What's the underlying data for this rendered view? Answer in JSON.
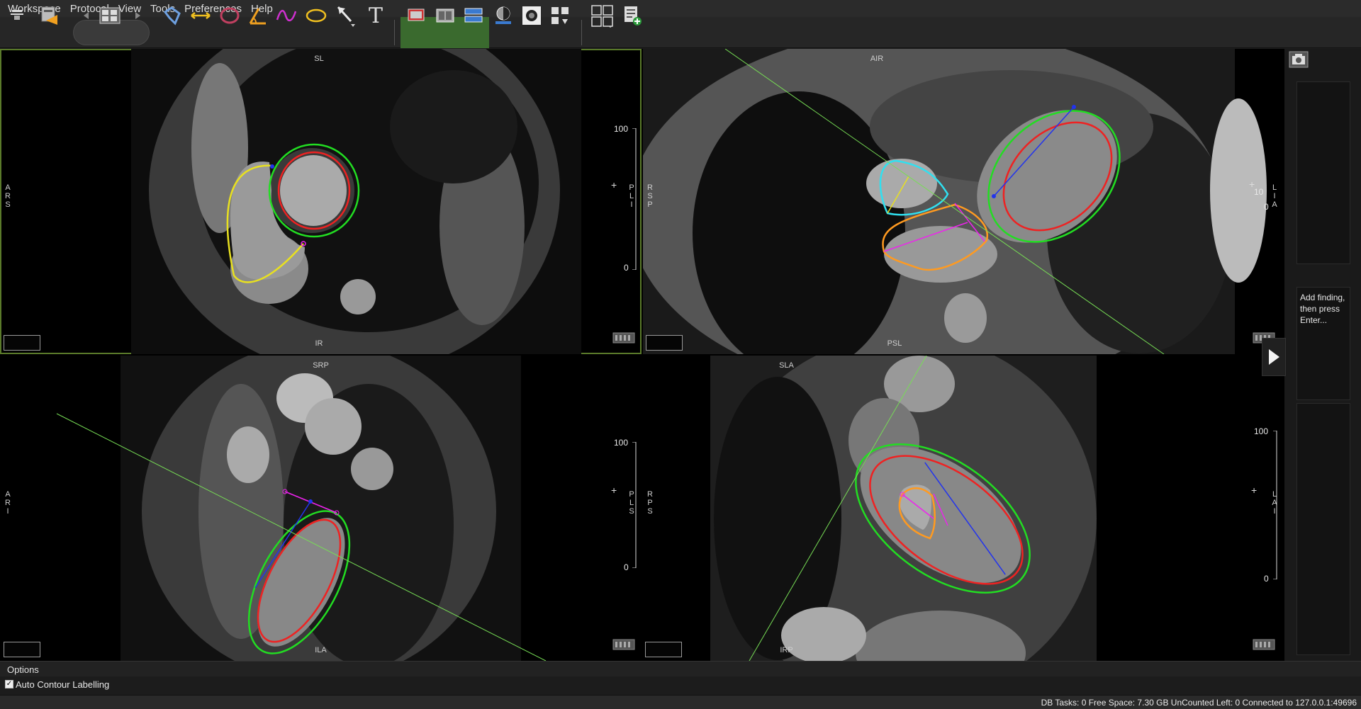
{
  "menu": [
    "Workspace",
    "Protocol",
    "View",
    "Tools",
    "Preferences",
    "Help"
  ],
  "toolbar": {
    "icons": [
      "screen-capture-icon",
      "import-series-icon",
      "prev-series-icon",
      "series-thumbnail-icon",
      "next-series-icon",
      "contour-tool-icon",
      "distance-ruler-icon",
      "ellipse-roi-icon",
      "angle-tool-icon",
      "freehand-tool-icon",
      "oval-roi-icon",
      "pointer-arrow-icon",
      "text-annotation-icon",
      "layout-a-icon",
      "layout-b-icon",
      "layout-c-icon",
      "window-level-icon",
      "invert-icon",
      "sync-icon",
      "grid-layout-icon",
      "report-add-icon"
    ],
    "text_tool": "T"
  },
  "viewports": {
    "tl": {
      "top": "SL",
      "bottom": "IR",
      "left": "A\nR\nS",
      "right": "P\nL\nI",
      "scale_top": "100",
      "scale_bottom": "0"
    },
    "tr": {
      "top": "AIR",
      "bottom": "PSL",
      "left": "R\nS\nP",
      "right": "L\nI\nA",
      "scale_top": "10",
      "scale_bottom": "0"
    },
    "bl": {
      "top": "SRP",
      "bottom": "ILA",
      "left": "A\nR\nI",
      "right": "P\nL\nS",
      "scale_top": "100",
      "scale_bottom": "0"
    },
    "br": {
      "top": "SLA",
      "bottom": "IRP",
      "left": "R\nP\nS",
      "right": "L\nA\nI",
      "scale_top": "100",
      "scale_bottom": "0"
    }
  },
  "right_panel": {
    "finding_text": "Add finding, then press Enter..."
  },
  "options": {
    "title": "Options",
    "auto_contour_label": "Auto Contour Labelling",
    "auto_contour_checked": true
  },
  "status": "DB Tasks: 0  Free Space: 7.30 GB  UnCounted Left: 0  Connected to 127.0.0.1:49696",
  "colors": {
    "epicardium": "#22dd22",
    "endocardium": "#ee2222",
    "rv": "#e8e020",
    "la": "#ff9a20",
    "ra": "#30e0f0",
    "long_axis": "#2233ee",
    "mitral": "#ee22ee",
    "plane_line": "#77dd55",
    "active_border": "#5a7a2a"
  }
}
